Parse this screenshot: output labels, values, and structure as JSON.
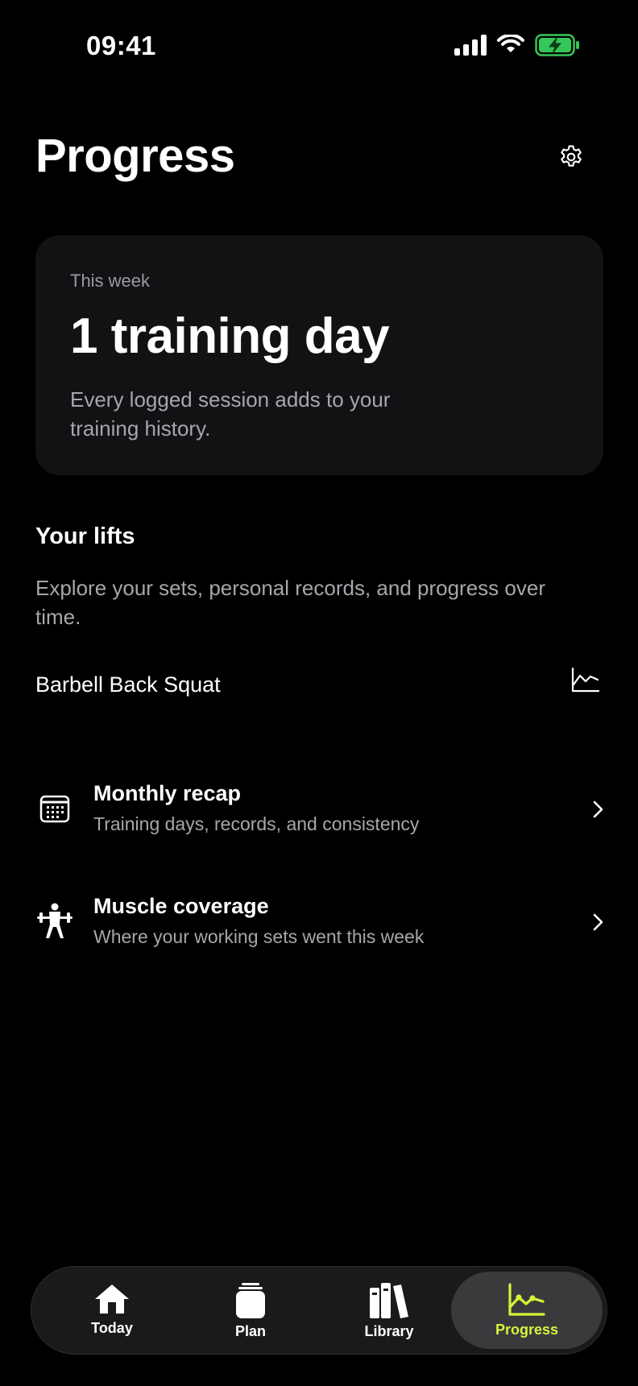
{
  "status_bar": {
    "time": "09:41",
    "icons": [
      "cellular-signal-icon",
      "wifi-icon",
      "battery-charging-icon"
    ],
    "battery_color": "#34c759"
  },
  "header": {
    "title": "Progress",
    "settings_icon": "gear-icon"
  },
  "week_card": {
    "label": "This week",
    "count": "1 training day",
    "description": "Every logged session adds to your training history."
  },
  "lifts": {
    "title": "Your lifts",
    "description": "Explore your sets, personal records, and progress over time.",
    "items": [
      {
        "name": "Barbell Back Squat",
        "icon": "line-chart-icon"
      }
    ]
  },
  "rows": [
    {
      "title": "Monthly recap",
      "subtitle": "Training days, records, and consistency",
      "icon": "calendar-icon"
    },
    {
      "title": "Muscle coverage",
      "subtitle": "Where your working sets went this week",
      "icon": "weightlifter-icon"
    }
  ],
  "tab_bar": {
    "active_color": "#d7f23a",
    "tabs": [
      {
        "label": "Today",
        "icon": "home-icon"
      },
      {
        "label": "Plan",
        "icon": "plan-stack-icon"
      },
      {
        "label": "Library",
        "icon": "books-icon"
      },
      {
        "label": "Progress",
        "icon": "progress-chart-icon",
        "active": true
      }
    ]
  }
}
